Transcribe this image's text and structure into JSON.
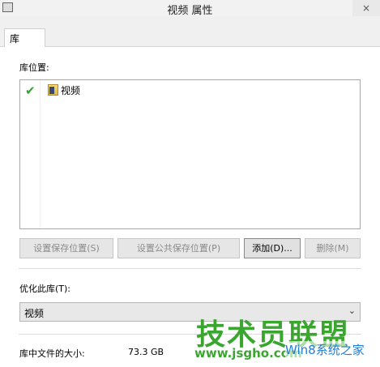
{
  "window": {
    "title": "视频 属性",
    "close_glyph": "×"
  },
  "tabs": [
    {
      "label": "库",
      "selected": true
    }
  ],
  "library_locations": {
    "label": "库位置:",
    "items": [
      {
        "name": "视频",
        "default_save": true
      }
    ]
  },
  "buttons": {
    "set_save_location": "设置保存位置(S)",
    "set_public_save_location": "设置公共保存位置(P)",
    "add": "添加(D)...",
    "remove": "删除(M)"
  },
  "optimize": {
    "label": "优化此库(T):",
    "selected": "视频"
  },
  "size_info": {
    "label": "库中文件的大小:",
    "value": "73.3 GB"
  },
  "watermark": {
    "main": "技术员联盟",
    "url": "www.jsgho.com",
    "sub": "Win8系统之家"
  },
  "colors": {
    "check": "#2ea52e",
    "watermark_green": "#3aa62f",
    "watermark_blue": "#1e7dd6"
  }
}
